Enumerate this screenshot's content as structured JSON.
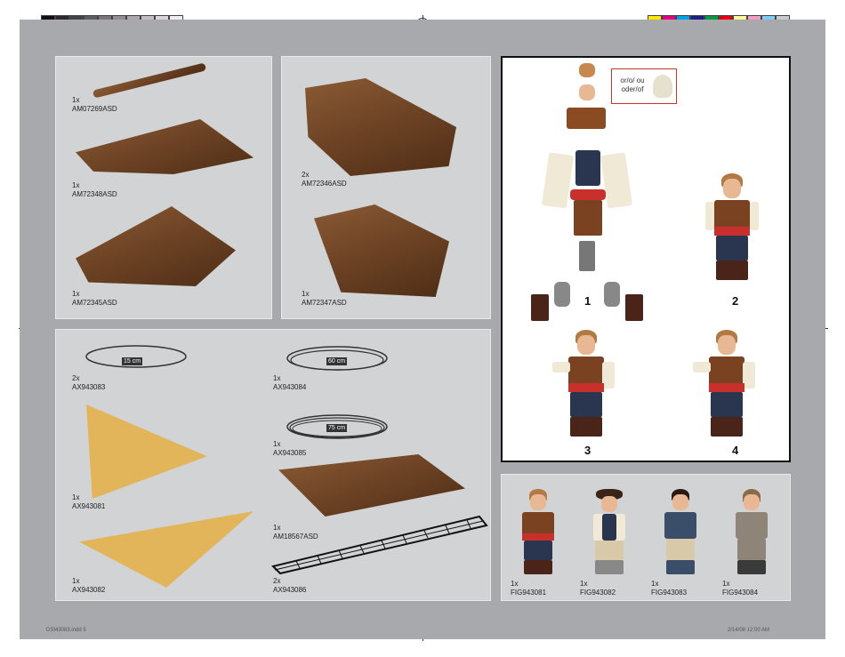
{
  "swatches": {
    "left": [
      "#111111",
      "#2b2b2b",
      "#444444",
      "#5e5e5e",
      "#777777",
      "#8f8f8f",
      "#a8a8a8",
      "#c0c0c0",
      "#d8d8d8",
      "#efefef"
    ],
    "right": [
      "#ffe600",
      "#e6007e",
      "#00a0e9",
      "#1d2088",
      "#009944",
      "#e60012",
      "#fff799",
      "#f19ec2",
      "#7ecef4",
      "#c9caca"
    ]
  },
  "panel_a": {
    "parts": [
      {
        "qty": "1x",
        "code": "AM07269ASD"
      },
      {
        "qty": "1x",
        "code": "AM72348ASD"
      },
      {
        "qty": "1x",
        "code": "AM72345ASD"
      }
    ]
  },
  "panel_b": {
    "parts": [
      {
        "qty": "2x",
        "code": "AM72346ASD"
      },
      {
        "qty": "1x",
        "code": "AM72347ASD"
      }
    ]
  },
  "panel_c": {
    "parts": [
      {
        "qty": "2x",
        "code": "AX943083",
        "length": "15 cm"
      },
      {
        "qty": "1x",
        "code": "AX943084",
        "length": "60 cm"
      },
      {
        "qty": "1x",
        "code": "AX943085",
        "length": "75 cm"
      },
      {
        "qty": "1x",
        "code": "AX943081"
      },
      {
        "qty": "1x",
        "code": "AM18567ASD"
      },
      {
        "qty": "1x",
        "code": "AX943082"
      },
      {
        "qty": "2x",
        "code": "AX943086"
      }
    ]
  },
  "assembly": {
    "alt_label": "or/o/ ou\noder/of",
    "steps": [
      "1",
      "2",
      "3",
      "4"
    ]
  },
  "figures": [
    {
      "qty": "1x",
      "code": "FIG943081"
    },
    {
      "qty": "1x",
      "code": "FIG943082"
    },
    {
      "qty": "1x",
      "code": "FIG943083"
    },
    {
      "qty": "1x",
      "code": "FIG943084"
    }
  ],
  "footer": {
    "left": "DSf43083.indd 5",
    "right": "2/14/08  12:00 AM"
  }
}
